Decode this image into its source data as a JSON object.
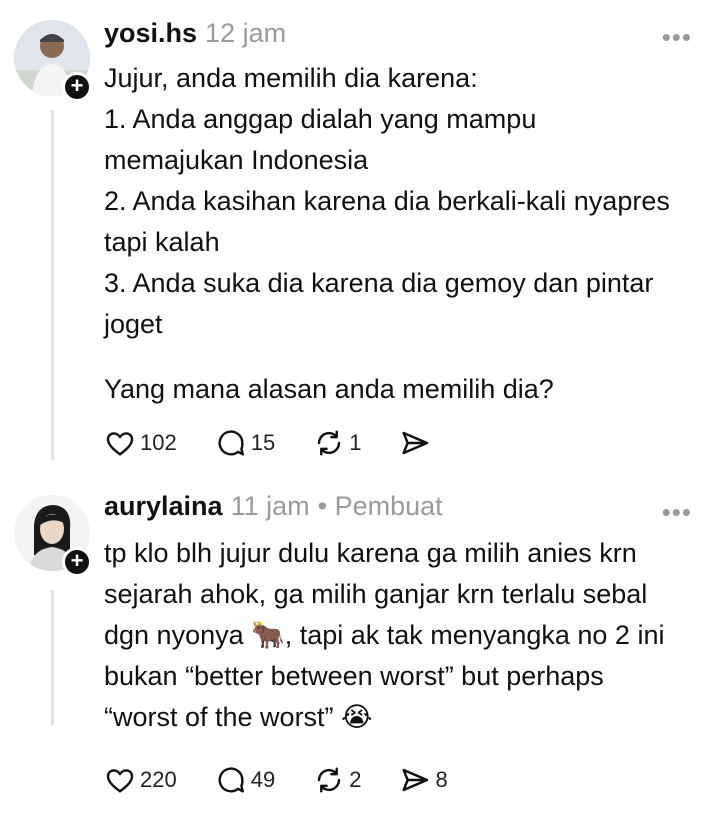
{
  "posts": [
    {
      "username": "yosi.hs",
      "time": "12 jam",
      "author_tag": "",
      "more": "•••",
      "lines": [
        "Jujur, anda memilih dia karena:",
        "1. Anda anggap dialah yang mampu",
        "memajukan Indonesia",
        "2. Anda kasihan karena dia berkali-kali nyapres",
        "tapi kalah",
        "3. Anda suka dia karena dia gemoy dan pintar",
        "joget"
      ],
      "last_line": "Yang mana alasan anda memilih dia?",
      "stats": {
        "likes": "102",
        "replies": "15",
        "reposts": "1",
        "shares": ""
      }
    },
    {
      "username": "aurylaina",
      "time": "11 jam",
      "author_tag": "• Pembuat",
      "more": "•••",
      "lines": [
        "tp klo blh jujur dulu karena ga milih anies krn",
        "sejarah ahok, ga milih ganjar krn terlalu sebal",
        "dgn nyonya 🐂, tapi ak tak menyangka no 2 ini",
        "bukan “better between worst” but perhaps",
        "“worst of the worst” 😭"
      ],
      "stats": {
        "likes": "220",
        "replies": "49",
        "reposts": "2",
        "shares": "8"
      }
    }
  ],
  "icons": [
    "heart-icon",
    "comment-icon",
    "repost-icon",
    "share-icon",
    "plus-icon"
  ]
}
